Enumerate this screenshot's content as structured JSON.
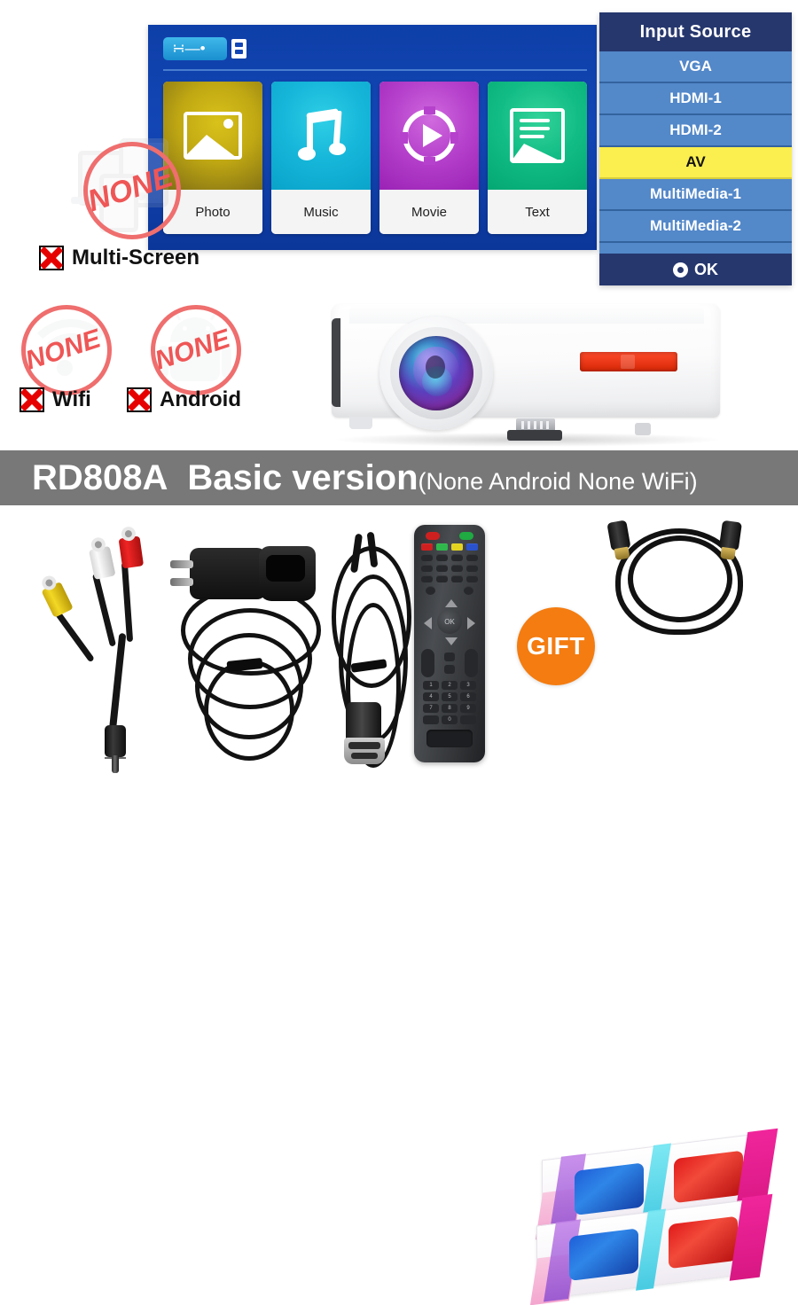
{
  "media_menu": {
    "usb_icon": "usb-icon",
    "tiles": [
      {
        "label": "Photo",
        "icon": "image-icon",
        "color": "#c0a813"
      },
      {
        "label": "Music",
        "icon": "music-note-icon",
        "color": "#16b7da"
      },
      {
        "label": "Movie",
        "icon": "play-circle-icon",
        "color": "#b641cc"
      },
      {
        "label": "Text",
        "icon": "document-icon",
        "color": "#12bd85"
      }
    ]
  },
  "input_source": {
    "title": "Input Source",
    "items": [
      {
        "label": "VGA",
        "selected": false
      },
      {
        "label": "HDMI-1",
        "selected": false
      },
      {
        "label": "HDMI-2",
        "selected": false
      },
      {
        "label": "AV",
        "selected": true
      },
      {
        "label": "MultiMedia-1",
        "selected": false
      },
      {
        "label": "MultiMedia-2",
        "selected": false
      }
    ],
    "footer_label": "OK",
    "selected_color": "#fbef4f",
    "header_color": "#26376e",
    "row_color": "#5388c9"
  },
  "feature_badges": [
    {
      "stamp": "NONE",
      "x_label": "Multi-Screen",
      "icon": "multiscreen-icon"
    },
    {
      "stamp": "NONE",
      "x_label": "Wifi",
      "icon": "wifi-icon"
    },
    {
      "stamp": "NONE",
      "x_label": "Android",
      "icon": "android-icon"
    }
  ],
  "banner": {
    "model": "RD808A",
    "version": "Basic version",
    "note": "(None Android None WiFi)",
    "background": "#787878",
    "text_color": "#ffffff"
  },
  "product": {
    "name": "projector",
    "lens_colors": [
      "#3f8fd0",
      "#5b3fbd",
      "#7b2ea6"
    ],
    "vent_color": "#d62706"
  },
  "accessories": [
    {
      "name": "av-rca-cable"
    },
    {
      "name": "power-cord"
    },
    {
      "name": "vga-cable"
    },
    {
      "name": "remote-control"
    },
    {
      "name": "hdmi-cable"
    },
    {
      "name": "3d-glasses"
    }
  ],
  "gift": {
    "label": "GIFT",
    "color": "#f47c10"
  },
  "remote": {
    "number_keys": [
      "1",
      "2",
      "3",
      "4",
      "5",
      "6",
      "7",
      "8",
      "9",
      "",
      "0",
      ""
    ],
    "ok_label": "OK",
    "color_keys": [
      "#cf2020",
      "#2fb84b",
      "#e3d320",
      "#2a52cf"
    ]
  }
}
